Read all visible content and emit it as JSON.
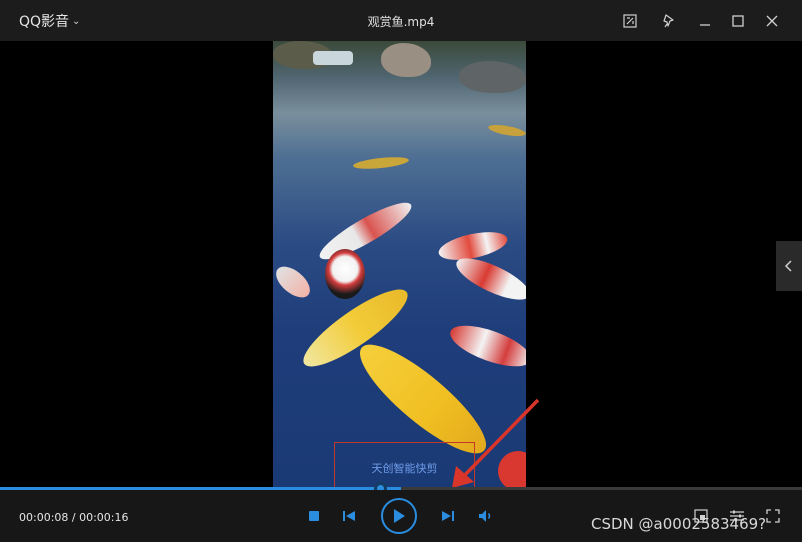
{
  "titlebar": {
    "app_name": "QQ影音",
    "window_title": "观赏鱼.mp4",
    "buttons": [
      "screenshot-icon",
      "pin-icon",
      "minimize-icon",
      "maximize-icon",
      "close-icon"
    ]
  },
  "video": {
    "caption_text": "天创智能快剪"
  },
  "player": {
    "time_readout": "00:00:08 / 00:00:16",
    "progress_fraction": 0.5,
    "accent_color": "#2a8de0"
  },
  "watermark": "CSDN @a0002583469?"
}
